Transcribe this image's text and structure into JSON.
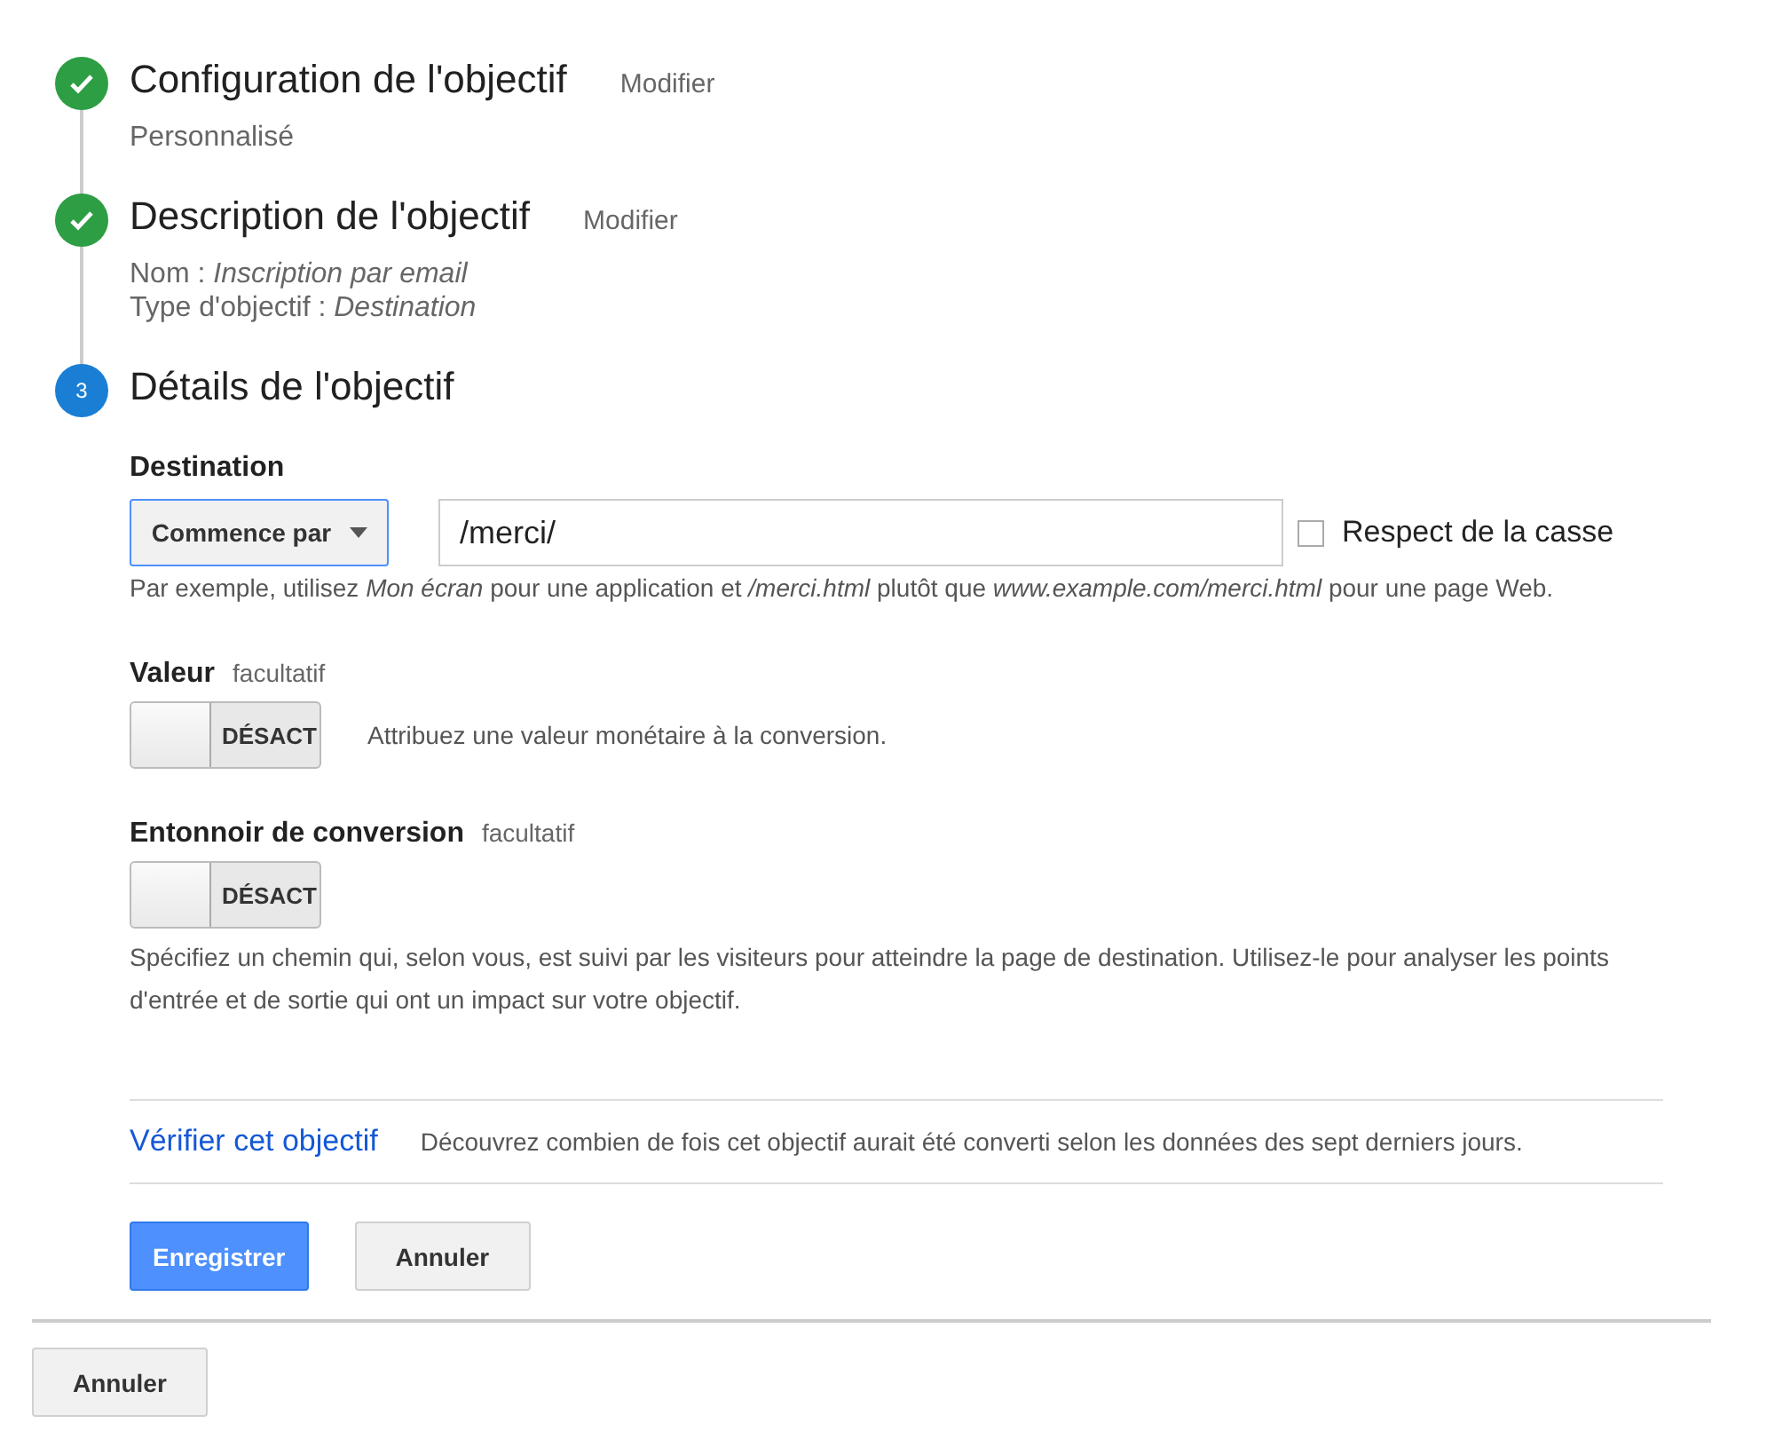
{
  "steps": [
    {
      "done": true,
      "title": "Configuration de l'objectif",
      "action": "Modifier",
      "details": [
        "Personnalisé"
      ]
    },
    {
      "done": true,
      "title": "Description de l'objectif",
      "action": "Modifier",
      "details": [
        "Nom : *Inscription par email*",
        "Type d'objectif : *Destination*"
      ]
    },
    {
      "done": false,
      "number": "3",
      "title": "Détails de l'objectif"
    }
  ],
  "destination": {
    "label": "Destination",
    "match_type": "Commence par",
    "value": "/merci/",
    "case_checkbox": {
      "label": "Respect de la casse",
      "checked": false
    },
    "hint": "Par exemple, utilisez *Mon écran* pour une application et */merci.html* plutôt que *www.example.com/merci.html* pour une page Web."
  },
  "options": [
    {
      "label": "Valeur",
      "optional": "facultatif",
      "toggle": {
        "on": false,
        "text": "DÉSACT"
      },
      "description": "Attribuez une valeur monétaire à la conversion.",
      "inline": true
    },
    {
      "label": "Entonnoir de conversion",
      "optional": "facultatif",
      "toggle": {
        "on": false,
        "text": "DÉSACT"
      },
      "description": "Spécifiez un chemin qui, selon vous, est suivi par les visiteurs pour atteindre la page de destination. Utilisez-le pour analyser les points d'entrée et de sortie qui ont un impact sur votre objectif.",
      "inline": false
    }
  ],
  "verify": {
    "link": "Vérifier cet objectif",
    "text": "Découvrez combien de fois cet objectif aurait été converti selon les données des sept derniers jours."
  },
  "buttons": [
    "Enregistrer",
    "Annuler"
  ],
  "footer_button": "Annuler"
}
